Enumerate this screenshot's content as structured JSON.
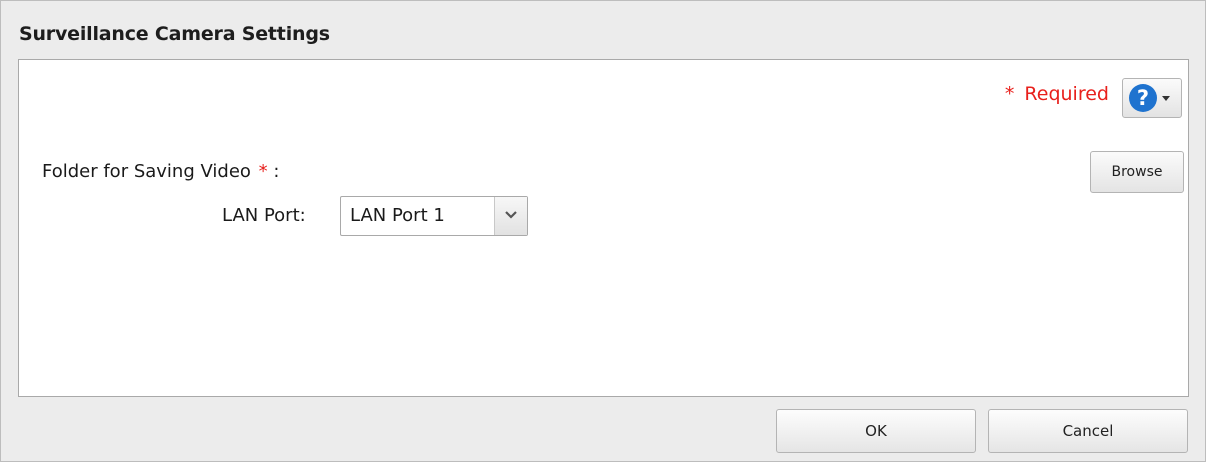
{
  "dialog": {
    "title": "Surveillance Camera Settings"
  },
  "required_note": {
    "star": "*",
    "label": "Required"
  },
  "help_button": {
    "glyph": "?",
    "icon": "help-circle-icon"
  },
  "folder_field": {
    "label": "Folder for Saving Video",
    "required_marker": "*",
    "colon": ":",
    "browse_label": "Browse"
  },
  "lan_port_field": {
    "label": "LAN Port:",
    "selected": "LAN Port 1"
  },
  "footer": {
    "ok_label": "OK",
    "cancel_label": "Cancel"
  },
  "colors": {
    "required": "#e8201c",
    "help_icon": "#1f73cf",
    "dialog_background": "#ececec",
    "panel_background": "#ffffff"
  }
}
